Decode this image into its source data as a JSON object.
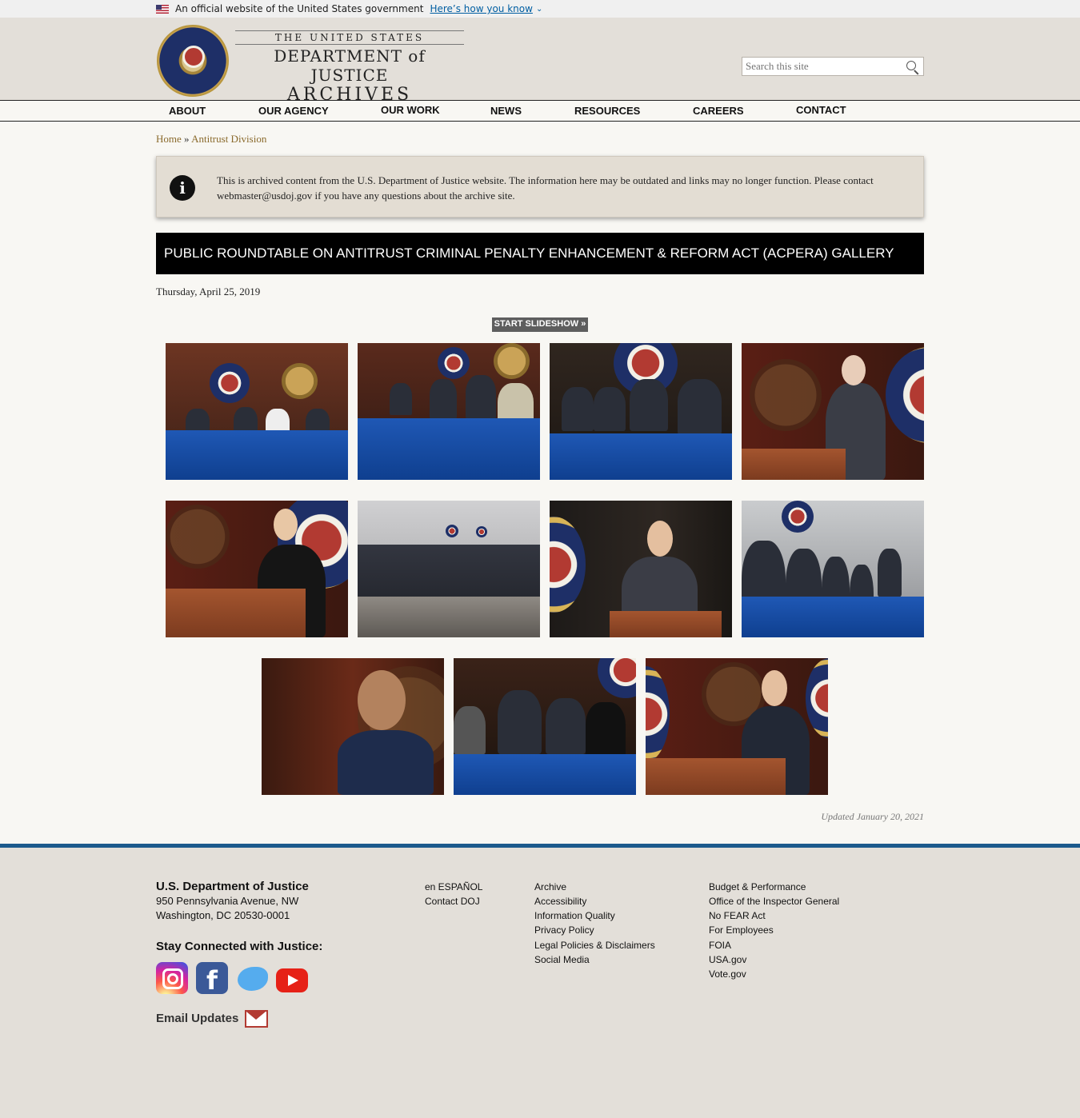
{
  "gov_banner": {
    "text": "An official website of the United States government",
    "link": "Here’s how you know"
  },
  "header": {
    "logo_line1": "THE UNITED STATES",
    "logo_line2": "DEPARTMENT of JUSTICE",
    "logo_line3": "ARCHIVES",
    "search_placeholder": "Search this site"
  },
  "nav": [
    "ABOUT",
    "OUR AGENCY",
    "OUR WORK",
    "NEWS",
    "RESOURCES",
    "CAREERS",
    "CONTACT"
  ],
  "breadcrumb": {
    "home": "Home",
    "separator": "»",
    "current": "Antitrust Division"
  },
  "notice": {
    "text": "This is archived content from the U.S. Department of Justice website. The information here may be outdated and links may no longer function. Please contact webmaster@usdoj.gov if you have any questions about the archive site."
  },
  "page": {
    "title": "PUBLIC ROUNDTABLE ON ANTITRUST CRIMINAL PENALTY ENHANCEMENT & REFORM ACT (ACPERA) GALLERY",
    "date": "Thursday, April 25, 2019",
    "slideshow_label": "START SLIDESHOW »",
    "updated": "Updated January 20, 2021"
  },
  "gallery_count": 11,
  "footer": {
    "org": "U.S. Department of Justice",
    "address_line1": "950 Pennsylvania Avenue, NW",
    "address_line2": "Washington, DC 20530-0001",
    "stay_connected": "Stay Connected with Justice:",
    "email_updates": "Email Updates",
    "col1": [
      "en ESPAÑOL",
      "Contact DOJ"
    ],
    "col2": [
      "Archive",
      "Accessibility",
      "Information Quality",
      "Privacy Policy",
      "Legal Policies & Disclaimers",
      "Social Media"
    ],
    "col3": [
      "Budget & Performance",
      "Office of the Inspector General",
      "No FEAR Act",
      "For Employees",
      "FOIA",
      "USA.gov",
      "Vote.gov"
    ]
  },
  "colors": {
    "header_bg": "#e3dfd9",
    "title_bar": "#000000",
    "footer_rule": "#1c5a8c",
    "breadcrumb_link": "#8a6a2c"
  }
}
